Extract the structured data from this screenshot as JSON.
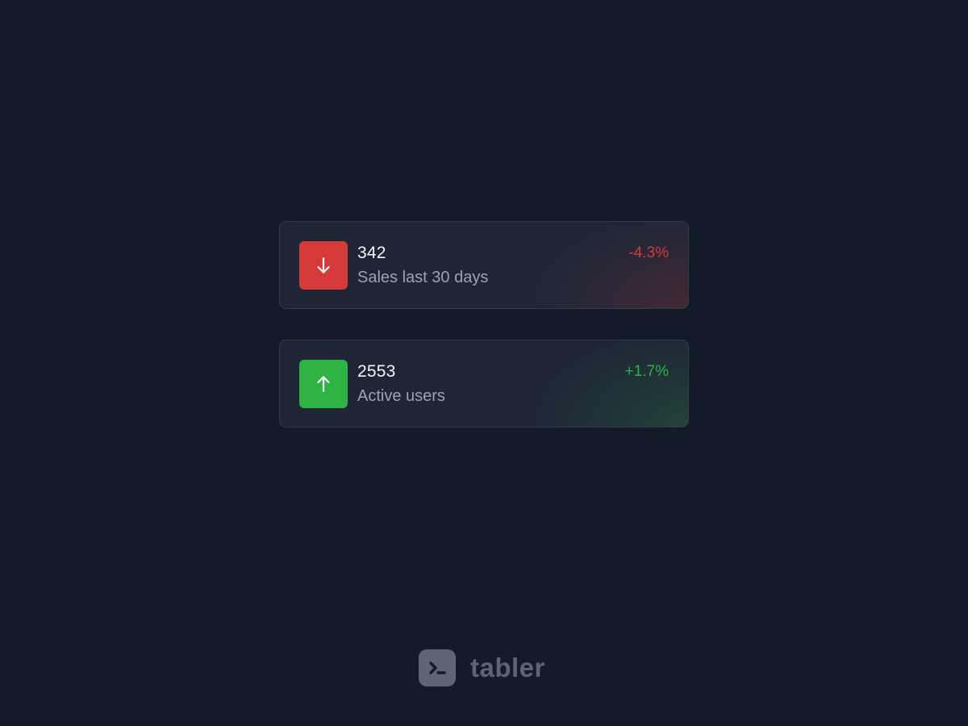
{
  "cards": [
    {
      "value": "342",
      "label": "Sales last 30 days",
      "change": "-4.3%",
      "trend_icon": "arrow-down-icon",
      "color": "#d63939"
    },
    {
      "value": "2553",
      "label": "Active users",
      "change": "+1.7%",
      "trend_icon": "arrow-up-icon",
      "color": "#2fb344"
    }
  ],
  "brand": {
    "name": "tabler",
    "logo_icon": "terminal-icon",
    "color": "#5e6472"
  },
  "theme": {
    "background": "#131a28",
    "card_background": "#1e2636",
    "card_border": "#323b4b",
    "value_color": "#f4f6fa",
    "label_color": "#9aa3b4"
  }
}
